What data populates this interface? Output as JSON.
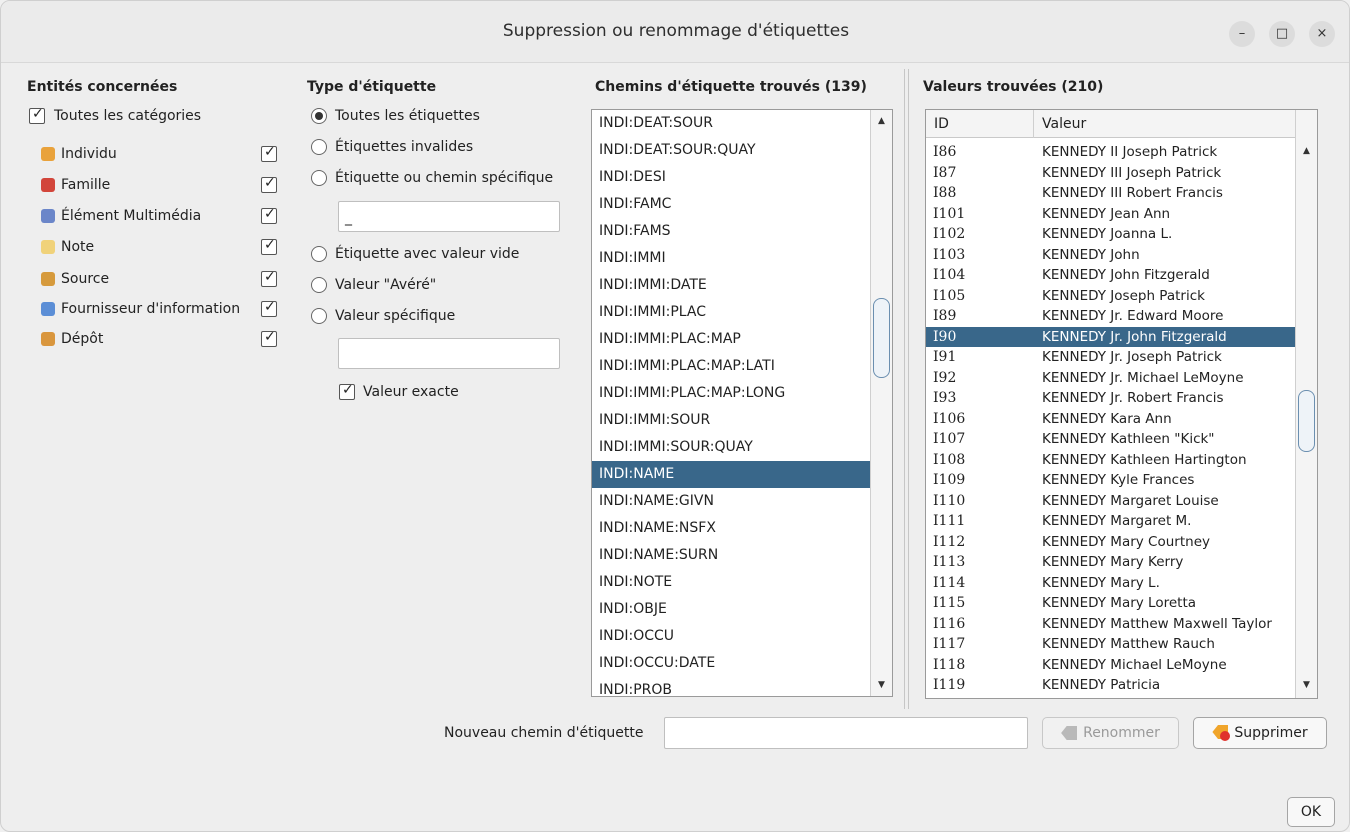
{
  "window": {
    "title": "Suppression ou renommage d'étiquettes",
    "controls": [
      "–",
      "□",
      "×"
    ]
  },
  "entities": {
    "title": "Entités concernées",
    "all_label": "Toutes les catégories",
    "all_checked": true,
    "items": [
      {
        "label": "Individu",
        "icon": "person-icon",
        "checked": true,
        "color": "#e9a23b"
      },
      {
        "label": "Famille",
        "icon": "family-icon",
        "checked": true,
        "color": "#d2453a"
      },
      {
        "label": "Élément Multimédia",
        "icon": "media-icon",
        "checked": true,
        "color": "#6b86c9"
      },
      {
        "label": "Note",
        "icon": "note-icon",
        "checked": true,
        "color": "#f0d27a"
      },
      {
        "label": "Source",
        "icon": "source-icon",
        "checked": true,
        "color": "#d69a3c"
      },
      {
        "label": "Fournisseur d'information",
        "icon": "provider-icon",
        "checked": true,
        "color": "#5b8ed6"
      },
      {
        "label": "Dépôt",
        "icon": "repository-icon",
        "checked": true,
        "color": "#d9963d"
      }
    ]
  },
  "tag_type": {
    "title": "Type d'étiquette",
    "options": [
      {
        "label": "Toutes les étiquettes",
        "selected": true
      },
      {
        "label": "Étiquettes invalides",
        "selected": false
      },
      {
        "label": "Étiquette ou chemin spécifique",
        "selected": false
      },
      {
        "label": "Étiquette avec valeur vide",
        "selected": false
      },
      {
        "label": "Valeur \"Avéré\"",
        "selected": false
      },
      {
        "label": "Valeur spécifique",
        "selected": false
      }
    ],
    "specific_path_value": "_",
    "specific_value": "",
    "exact_label": "Valeur exacte",
    "exact_checked": true
  },
  "paths": {
    "title": "Chemins d'étiquette trouvés (139)",
    "selected": "INDI:NAME",
    "items": [
      "INDI:DEAT:SOUR",
      "INDI:DEAT:SOUR:QUAY",
      "INDI:DESI",
      "INDI:FAMC",
      "INDI:FAMS",
      "INDI:IMMI",
      "INDI:IMMI:DATE",
      "INDI:IMMI:PLAC",
      "INDI:IMMI:PLAC:MAP",
      "INDI:IMMI:PLAC:MAP:LATI",
      "INDI:IMMI:PLAC:MAP:LONG",
      "INDI:IMMI:SOUR",
      "INDI:IMMI:SOUR:QUAY",
      "INDI:NAME",
      "INDI:NAME:GIVN",
      "INDI:NAME:NSFX",
      "INDI:NAME:SURN",
      "INDI:NOTE",
      "INDI:OBJE",
      "INDI:OCCU",
      "INDI:OCCU:DATE",
      "INDI:PROB"
    ]
  },
  "values": {
    "title": "Valeurs trouvées (210)",
    "col_id": "ID",
    "col_value": "Valeur",
    "selected_id": "I90",
    "rows": [
      {
        "id": "I86",
        "value": "KENNEDY II Joseph Patrick"
      },
      {
        "id": "I87",
        "value": "KENNEDY III Joseph Patrick"
      },
      {
        "id": "I88",
        "value": "KENNEDY III Robert Francis"
      },
      {
        "id": "I101",
        "value": "KENNEDY Jean Ann"
      },
      {
        "id": "I102",
        "value": "KENNEDY Joanna L."
      },
      {
        "id": "I103",
        "value": "KENNEDY John"
      },
      {
        "id": "I104",
        "value": "KENNEDY John Fitzgerald"
      },
      {
        "id": "I105",
        "value": "KENNEDY Joseph Patrick"
      },
      {
        "id": "I89",
        "value": "KENNEDY Jr. Edward Moore"
      },
      {
        "id": "I90",
        "value": "KENNEDY Jr. John Fitzgerald"
      },
      {
        "id": "I91",
        "value": "KENNEDY Jr. Joseph Patrick"
      },
      {
        "id": "I92",
        "value": "KENNEDY Jr. Michael LeMoyne"
      },
      {
        "id": "I93",
        "value": "KENNEDY Jr. Robert Francis"
      },
      {
        "id": "I106",
        "value": "KENNEDY Kara Ann"
      },
      {
        "id": "I107",
        "value": "KENNEDY Kathleen \"Kick\""
      },
      {
        "id": "I108",
        "value": "KENNEDY Kathleen Hartington"
      },
      {
        "id": "I109",
        "value": "KENNEDY Kyle Frances"
      },
      {
        "id": "I110",
        "value": "KENNEDY Margaret Louise"
      },
      {
        "id": "I111",
        "value": "KENNEDY Margaret M."
      },
      {
        "id": "I112",
        "value": "KENNEDY Mary Courtney"
      },
      {
        "id": "I113",
        "value": "KENNEDY Mary Kerry"
      },
      {
        "id": "I114",
        "value": "KENNEDY Mary L."
      },
      {
        "id": "I115",
        "value": "KENNEDY Mary Loretta"
      },
      {
        "id": "I116",
        "value": "KENNEDY Matthew Maxwell Taylor"
      },
      {
        "id": "I117",
        "value": "KENNEDY Matthew Rauch"
      },
      {
        "id": "I118",
        "value": "KENNEDY Michael LeMoyne"
      },
      {
        "id": "I119",
        "value": "KENNEDY Patricia"
      }
    ]
  },
  "footer": {
    "new_path_label": "Nouveau chemin d'étiquette",
    "new_path_value": "",
    "rename_label": "Renommer",
    "delete_label": "Supprimer",
    "ok_label": "OK"
  },
  "colors": {
    "selection": "#39678a",
    "delete_icon": "#f0a52b"
  }
}
